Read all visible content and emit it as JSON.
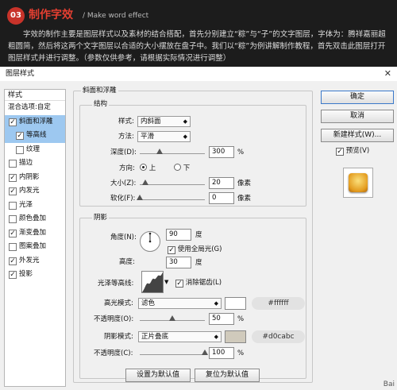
{
  "header": {
    "badge": "03",
    "title": "制作字效",
    "subtitle": "/ Make word effect",
    "desc": "字效的制作主要是图层样式以及素材的结合搭配，首先分别建立“粽”与“子”的文字图层，字体为：腾祥嘉丽超粗圆简，然后将这两个文字图层以合适的大小摆放在盘子中。我们以“粽”为例讲解制作教程，首先双击此图层打开图层样式并进行调整。（参数仅供参考，请根据实际情况进行调整）"
  },
  "dialog": {
    "title": "图层样式",
    "close": "✕",
    "left": {
      "header": "样式",
      "blend": "混合选项:自定",
      "items": [
        {
          "label": "斜面和浮雕",
          "checked": true,
          "selected": true,
          "sub": false
        },
        {
          "label": "等高线",
          "checked": true,
          "selected": true,
          "sub": true
        },
        {
          "label": "纹理",
          "checked": false,
          "selected": false,
          "sub": true
        },
        {
          "label": "描边",
          "checked": false,
          "selected": false,
          "sub": false
        },
        {
          "label": "内阴影",
          "checked": true,
          "selected": false,
          "sub": false
        },
        {
          "label": "内发光",
          "checked": true,
          "selected": false,
          "sub": false
        },
        {
          "label": "光泽",
          "checked": false,
          "selected": false,
          "sub": false
        },
        {
          "label": "颜色叠加",
          "checked": false,
          "selected": false,
          "sub": false
        },
        {
          "label": "渐变叠加",
          "checked": true,
          "selected": false,
          "sub": false
        },
        {
          "label": "图案叠加",
          "checked": false,
          "selected": false,
          "sub": false
        },
        {
          "label": "外发光",
          "checked": true,
          "selected": false,
          "sub": false
        },
        {
          "label": "投影",
          "checked": true,
          "selected": false,
          "sub": false
        }
      ]
    },
    "bevel": {
      "title": "斜面和浮雕",
      "struct": "结构",
      "style_label": "样式:",
      "style_value": "内斜面",
      "method_label": "方法:",
      "method_value": "平滑",
      "depth_label": "深度(D):",
      "depth_value": "300",
      "depth_unit": "%",
      "depth_level": 0.3,
      "dir_label": "方向:",
      "dir_up": "上",
      "dir_down": "下",
      "size_label": "大小(Z):",
      "size_value": "20",
      "size_unit": "像素",
      "size_level": 0.08,
      "soften_label": "软化(F):",
      "soften_value": "0",
      "soften_unit": "像素",
      "soften_level": 0.0
    },
    "shading": {
      "title": "阴影",
      "angle_label": "角度(N):",
      "angle_value": "90",
      "angle_unit": "度",
      "global_light": "使用全局光(G)",
      "altitude_label": "高度:",
      "altitude_value": "30",
      "altitude_unit": "度",
      "gloss_label": "光泽等高线:",
      "antialias": "消除锯齿(L)",
      "hl_label": "高光模式:",
      "hl_value": "滤色",
      "hl_color": "#ffffff",
      "hl_op_label": "不透明度(O):",
      "hl_op_value": "50",
      "hl_op_unit": "%",
      "hl_op_level": 0.5,
      "sh_label": "阴影模式:",
      "sh_value": "正片叠底",
      "sh_color": "#d0cabc",
      "sh_op_label": "不透明度(C):",
      "sh_op_value": "100",
      "sh_op_unit": "%",
      "sh_op_level": 1.0
    },
    "buttons": {
      "ok": "确定",
      "cancel": "取消",
      "new_style": "新建样式(W)...",
      "preview": "预览(V)",
      "set_default": "设置为默认值",
      "reset_default": "复位为默认值"
    },
    "watermark": "Bai"
  }
}
